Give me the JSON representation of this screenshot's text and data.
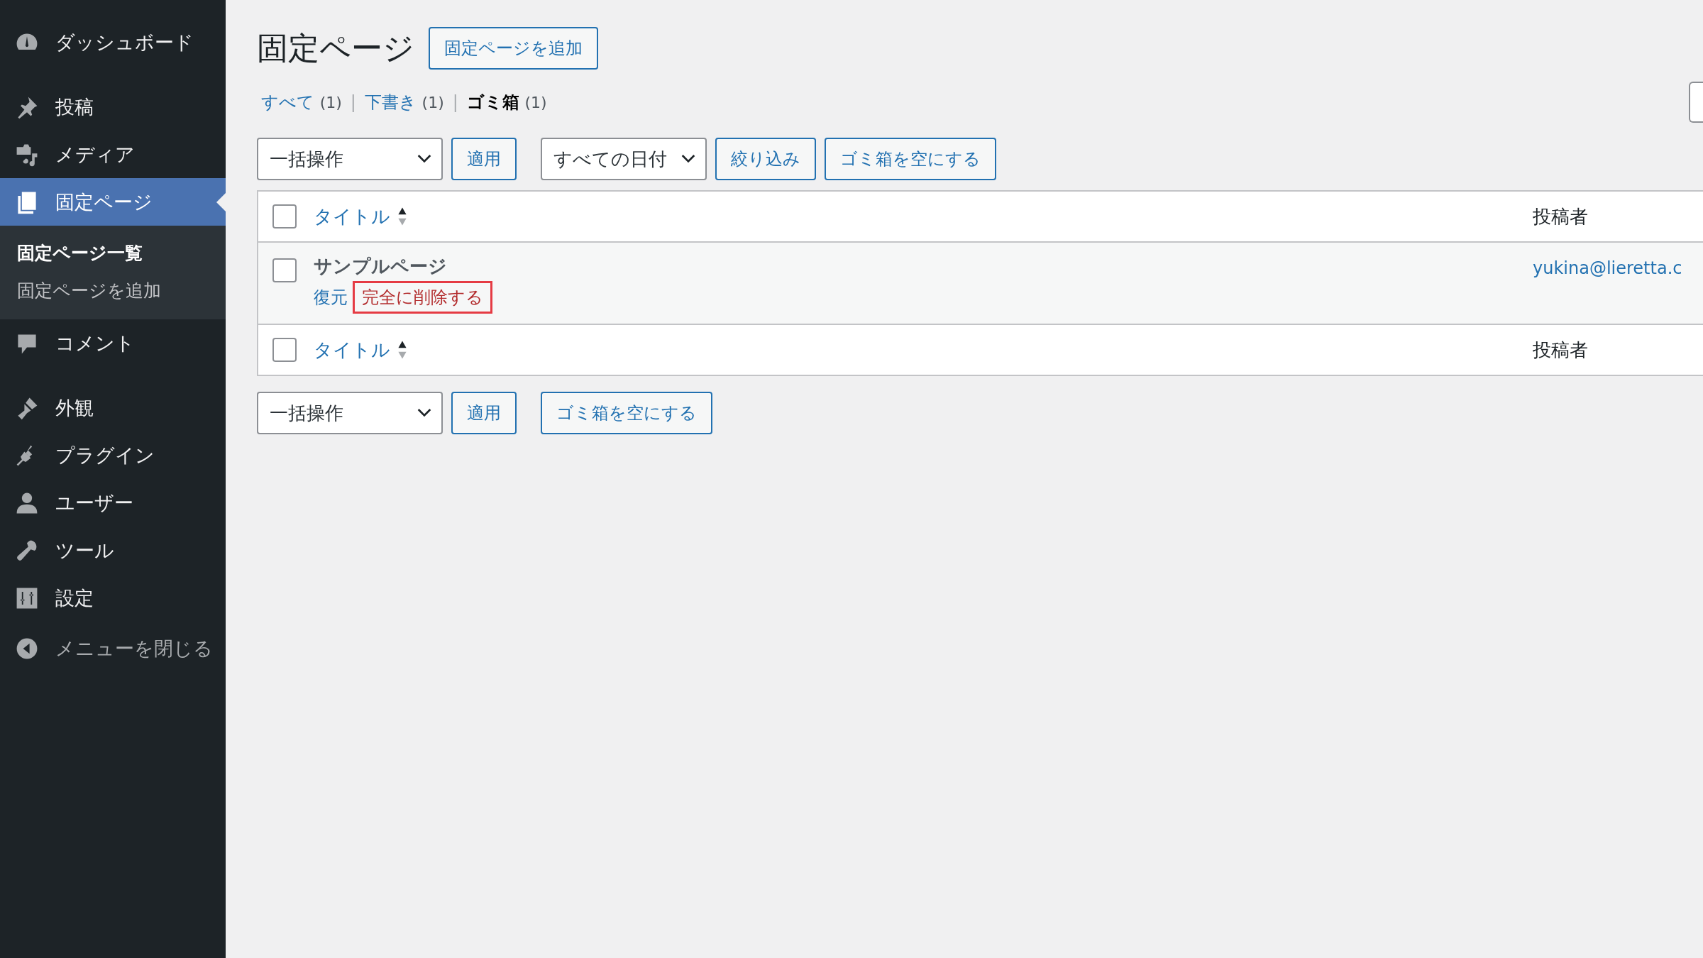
{
  "sidebar": {
    "items": [
      {
        "label": "ダッシュボード",
        "selected": false,
        "kind": "top"
      },
      {
        "label": "投稿",
        "selected": false,
        "kind": "menu"
      },
      {
        "label": "メディア",
        "selected": false,
        "kind": "menu"
      },
      {
        "label": "固定ページ",
        "selected": true,
        "kind": "menu",
        "children": [
          {
            "label": "固定ページ一覧",
            "selected": true
          },
          {
            "label": "固定ページを追加",
            "selected": false
          }
        ]
      },
      {
        "label": "コメント",
        "selected": false,
        "kind": "menu"
      },
      {
        "label": "外観",
        "selected": false,
        "kind": "group"
      },
      {
        "label": "プラグイン",
        "selected": false,
        "kind": "menu"
      },
      {
        "label": "ユーザー",
        "selected": false,
        "kind": "menu"
      },
      {
        "label": "ツール",
        "selected": false,
        "kind": "menu"
      },
      {
        "label": "設定",
        "selected": false,
        "kind": "menu"
      },
      {
        "label": "メニューを閉じる",
        "selected": false,
        "kind": "collapse"
      }
    ]
  },
  "page": {
    "title": "固定ページ",
    "add_button": "固定ページを追加"
  },
  "views": [
    {
      "label": "すべて",
      "count": "(1)",
      "selected": false
    },
    {
      "separator": "|",
      "label": "下書き",
      "count": "(1)",
      "selected": false
    },
    {
      "separator": "|",
      "label": "ゴミ箱",
      "count": "(1)",
      "selected": true
    }
  ],
  "top_toolbar": {
    "bulk_action": "一括操作",
    "apply": "適用",
    "date_filter": "すべての日付",
    "filter": "絞り込み",
    "empty_trash": "ゴミ箱を空にする"
  },
  "table": {
    "header": {
      "checked": false,
      "columns": [
        {
          "label": "タイトル",
          "sortable": true
        },
        {
          "label": "投稿者",
          "sortable": false
        }
      ]
    },
    "rows": [
      {
        "checked": false,
        "title": "サンプルページ",
        "author": "yukina@lieretta.c",
        "actions": [
          {
            "label": "復元",
            "kind": "normal",
            "highlighted": false
          },
          {
            "label": "完全に削除する",
            "kind": "delete",
            "highlighted": true
          }
        ]
      }
    ],
    "footer": {
      "checked": false,
      "columns": [
        {
          "label": "タイトル",
          "sortable": true
        },
        {
          "label": "投稿者",
          "sortable": false
        }
      ]
    }
  },
  "bottom_toolbar": {
    "bulk_action": "一括操作",
    "apply": "適用",
    "empty_trash": "ゴミ箱を空にする"
  }
}
